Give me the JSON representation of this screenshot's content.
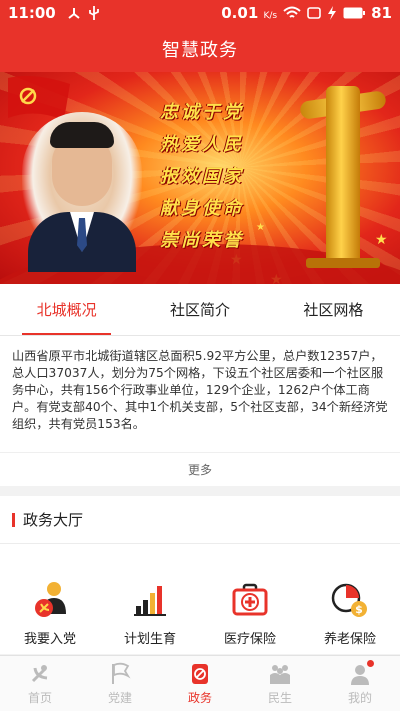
{
  "status_bar": {
    "time": "11:00",
    "speed": "0.01",
    "speed_unit": "K/s",
    "battery": "81"
  },
  "header": {
    "title": "智慧政务"
  },
  "banner": {
    "slogans": [
      "忠诚于党",
      "热爱人民",
      "报效国家",
      "献身使命",
      "崇尚荣誉"
    ]
  },
  "tabs": [
    {
      "label": "北城概况",
      "active": true
    },
    {
      "label": "社区简介",
      "active": false
    },
    {
      "label": "社区网格",
      "active": false
    }
  ],
  "intro": {
    "text": "山西省原平市北城街道辖区总面积5.92平方公里，总户数12357户，总人口37037人，划分为75个网格，下设五个社区居委和一个社区服务中心，共有156个行政事业单位，129个企业，1262户个体工商户。有党支部40个、其中1个机关支部，5个社区支部，34个新经济党组织，共有党员153名。",
    "more_label": "更多"
  },
  "hall": {
    "title": "政务大厅",
    "services": [
      {
        "label": "我要入党",
        "icon": "party-member-icon"
      },
      {
        "label": "计划生育",
        "icon": "bar-chart-icon"
      },
      {
        "label": "医疗保险",
        "icon": "medical-kit-icon"
      },
      {
        "label": "养老保险",
        "icon": "pension-pie-icon"
      }
    ]
  },
  "bottom_nav": [
    {
      "label": "首页",
      "icon": "party-emblem-icon",
      "active": false
    },
    {
      "label": "党建",
      "icon": "flag-icon",
      "active": false
    },
    {
      "label": "政务",
      "icon": "government-icon",
      "active": true
    },
    {
      "label": "民生",
      "icon": "people-icon",
      "active": false
    },
    {
      "label": "我的",
      "icon": "person-icon",
      "active": false
    }
  ],
  "colors": {
    "brand_red": "#e8332a",
    "inactive_gray": "#bbbbbb"
  }
}
